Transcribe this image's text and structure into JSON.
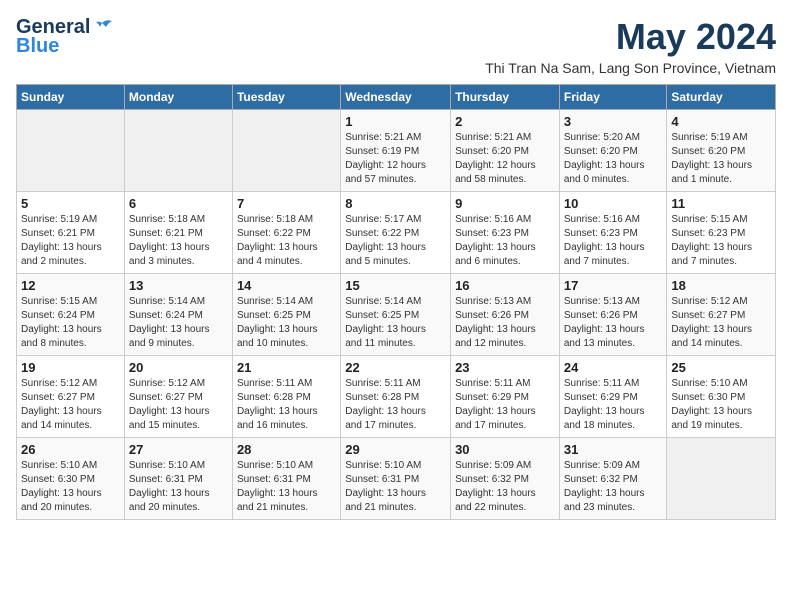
{
  "logo": {
    "line1": "General",
    "line2": "Blue"
  },
  "title": {
    "month_year": "May 2024",
    "location": "Thi Tran Na Sam, Lang Son Province, Vietnam"
  },
  "headers": [
    "Sunday",
    "Monday",
    "Tuesday",
    "Wednesday",
    "Thursday",
    "Friday",
    "Saturday"
  ],
  "weeks": [
    [
      {
        "day": "",
        "info": ""
      },
      {
        "day": "",
        "info": ""
      },
      {
        "day": "",
        "info": ""
      },
      {
        "day": "1",
        "info": "Sunrise: 5:21 AM\nSunset: 6:19 PM\nDaylight: 12 hours\nand 57 minutes."
      },
      {
        "day": "2",
        "info": "Sunrise: 5:21 AM\nSunset: 6:20 PM\nDaylight: 12 hours\nand 58 minutes."
      },
      {
        "day": "3",
        "info": "Sunrise: 5:20 AM\nSunset: 6:20 PM\nDaylight: 13 hours\nand 0 minutes."
      },
      {
        "day": "4",
        "info": "Sunrise: 5:19 AM\nSunset: 6:20 PM\nDaylight: 13 hours\nand 1 minute."
      }
    ],
    [
      {
        "day": "5",
        "info": "Sunrise: 5:19 AM\nSunset: 6:21 PM\nDaylight: 13 hours\nand 2 minutes."
      },
      {
        "day": "6",
        "info": "Sunrise: 5:18 AM\nSunset: 6:21 PM\nDaylight: 13 hours\nand 3 minutes."
      },
      {
        "day": "7",
        "info": "Sunrise: 5:18 AM\nSunset: 6:22 PM\nDaylight: 13 hours\nand 4 minutes."
      },
      {
        "day": "8",
        "info": "Sunrise: 5:17 AM\nSunset: 6:22 PM\nDaylight: 13 hours\nand 5 minutes."
      },
      {
        "day": "9",
        "info": "Sunrise: 5:16 AM\nSunset: 6:23 PM\nDaylight: 13 hours\nand 6 minutes."
      },
      {
        "day": "10",
        "info": "Sunrise: 5:16 AM\nSunset: 6:23 PM\nDaylight: 13 hours\nand 7 minutes."
      },
      {
        "day": "11",
        "info": "Sunrise: 5:15 AM\nSunset: 6:23 PM\nDaylight: 13 hours\nand 7 minutes."
      }
    ],
    [
      {
        "day": "12",
        "info": "Sunrise: 5:15 AM\nSunset: 6:24 PM\nDaylight: 13 hours\nand 8 minutes."
      },
      {
        "day": "13",
        "info": "Sunrise: 5:14 AM\nSunset: 6:24 PM\nDaylight: 13 hours\nand 9 minutes."
      },
      {
        "day": "14",
        "info": "Sunrise: 5:14 AM\nSunset: 6:25 PM\nDaylight: 13 hours\nand 10 minutes."
      },
      {
        "day": "15",
        "info": "Sunrise: 5:14 AM\nSunset: 6:25 PM\nDaylight: 13 hours\nand 11 minutes."
      },
      {
        "day": "16",
        "info": "Sunrise: 5:13 AM\nSunset: 6:26 PM\nDaylight: 13 hours\nand 12 minutes."
      },
      {
        "day": "17",
        "info": "Sunrise: 5:13 AM\nSunset: 6:26 PM\nDaylight: 13 hours\nand 13 minutes."
      },
      {
        "day": "18",
        "info": "Sunrise: 5:12 AM\nSunset: 6:27 PM\nDaylight: 13 hours\nand 14 minutes."
      }
    ],
    [
      {
        "day": "19",
        "info": "Sunrise: 5:12 AM\nSunset: 6:27 PM\nDaylight: 13 hours\nand 14 minutes."
      },
      {
        "day": "20",
        "info": "Sunrise: 5:12 AM\nSunset: 6:27 PM\nDaylight: 13 hours\nand 15 minutes."
      },
      {
        "day": "21",
        "info": "Sunrise: 5:11 AM\nSunset: 6:28 PM\nDaylight: 13 hours\nand 16 minutes."
      },
      {
        "day": "22",
        "info": "Sunrise: 5:11 AM\nSunset: 6:28 PM\nDaylight: 13 hours\nand 17 minutes."
      },
      {
        "day": "23",
        "info": "Sunrise: 5:11 AM\nSunset: 6:29 PM\nDaylight: 13 hours\nand 17 minutes."
      },
      {
        "day": "24",
        "info": "Sunrise: 5:11 AM\nSunset: 6:29 PM\nDaylight: 13 hours\nand 18 minutes."
      },
      {
        "day": "25",
        "info": "Sunrise: 5:10 AM\nSunset: 6:30 PM\nDaylight: 13 hours\nand 19 minutes."
      }
    ],
    [
      {
        "day": "26",
        "info": "Sunrise: 5:10 AM\nSunset: 6:30 PM\nDaylight: 13 hours\nand 20 minutes."
      },
      {
        "day": "27",
        "info": "Sunrise: 5:10 AM\nSunset: 6:31 PM\nDaylight: 13 hours\nand 20 minutes."
      },
      {
        "day": "28",
        "info": "Sunrise: 5:10 AM\nSunset: 6:31 PM\nDaylight: 13 hours\nand 21 minutes."
      },
      {
        "day": "29",
        "info": "Sunrise: 5:10 AM\nSunset: 6:31 PM\nDaylight: 13 hours\nand 21 minutes."
      },
      {
        "day": "30",
        "info": "Sunrise: 5:09 AM\nSunset: 6:32 PM\nDaylight: 13 hours\nand 22 minutes."
      },
      {
        "day": "31",
        "info": "Sunrise: 5:09 AM\nSunset: 6:32 PM\nDaylight: 13 hours\nand 23 minutes."
      },
      {
        "day": "",
        "info": ""
      }
    ]
  ]
}
